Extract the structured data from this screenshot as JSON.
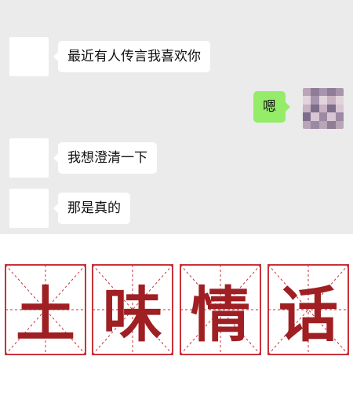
{
  "chat": {
    "messages": [
      {
        "side": "left",
        "text": "最近有人传言我喜欢你"
      },
      {
        "side": "right",
        "text": "嗯"
      },
      {
        "side": "left",
        "text": "我想澄清一下"
      },
      {
        "side": "left",
        "text": "那是真的"
      }
    ]
  },
  "title": {
    "characters": [
      "土",
      "味",
      "情",
      "话"
    ]
  },
  "colors": {
    "chat_background": "#ebebeb",
    "bubble_left": "#ffffff",
    "bubble_right": "#95ec69",
    "title_red": "#9f1f23",
    "grid_red": "#c8323a"
  },
  "icons": {
    "sender_avatar": "avatar-placeholder",
    "self_avatar": "pixelated-avatar"
  }
}
